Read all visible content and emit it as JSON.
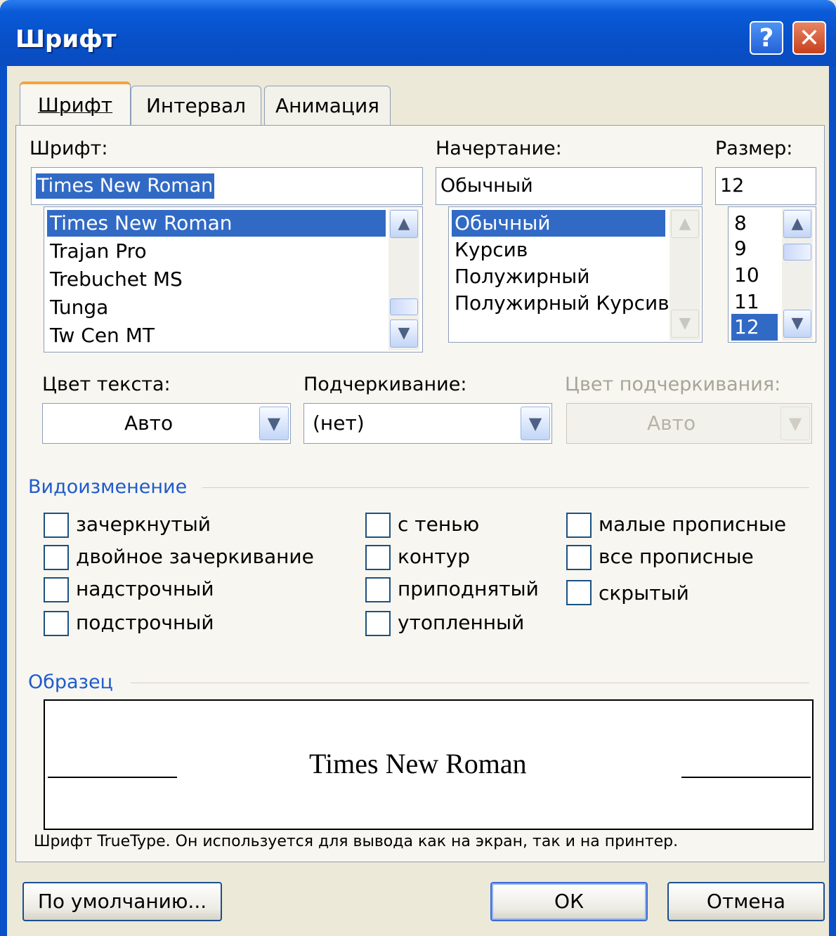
{
  "window": {
    "title": "Шрифт",
    "help_icon": "question-icon",
    "close_icon": "close-icon",
    "help_glyph": "?",
    "close_glyph": "✕"
  },
  "tabs": [
    {
      "label": "Шрифт",
      "active": true
    },
    {
      "label": "Интервал",
      "active": false
    },
    {
      "label": "Анимация",
      "active": false
    }
  ],
  "font": {
    "label": "Шрифт:",
    "value": "Times New Roman",
    "items": [
      "Times New Roman",
      "Trajan Pro",
      "Trebuchet MS",
      "Tunga",
      "Tw Cen MT"
    ],
    "selected": "Times New Roman"
  },
  "style": {
    "label": "Начертание:",
    "value": "Обычный",
    "items": [
      "Обычный",
      "Курсив",
      "Полужирный",
      "Полужирный Курсив"
    ],
    "selected": "Обычный"
  },
  "size": {
    "label": "Размер:",
    "value": "12",
    "items": [
      "8",
      "9",
      "10",
      "11",
      "12"
    ],
    "selected": "12"
  },
  "text_color": {
    "label": "Цвет текста:",
    "value": "Авто"
  },
  "underline": {
    "label": "Подчеркивание:",
    "value": "(нет)"
  },
  "underline_color": {
    "label": "Цвет подчеркивания:",
    "value": "Авто",
    "disabled": true
  },
  "effects": {
    "title": "Видоизменение",
    "items": [
      {
        "label": "зачеркнутый",
        "checked": false
      },
      {
        "label": "двойное зачеркивание",
        "checked": false
      },
      {
        "label": "надстрочный",
        "checked": false
      },
      {
        "label": "подстрочный",
        "checked": false
      },
      {
        "label": "с тенью",
        "checked": false
      },
      {
        "label": "контур",
        "checked": false
      },
      {
        "label": "приподнятый",
        "checked": false
      },
      {
        "label": "утопленный",
        "checked": false
      },
      {
        "label": "малые прописные",
        "checked": false
      },
      {
        "label": "все прописные",
        "checked": false
      },
      {
        "label": "скрытый",
        "checked": false
      }
    ]
  },
  "preview": {
    "title": "Образец",
    "text": "Times New Roman",
    "note": "Шрифт TrueType. Он используется для вывода как на экран, так и на принтер."
  },
  "buttons": {
    "default": "По умолчанию...",
    "ok": "ОК",
    "cancel": "Отмена"
  },
  "colors": {
    "titlebar": "#0750c8",
    "selection": "#316ac5",
    "group_title": "#1f5bcc",
    "dialog_bg": "#ece9d8"
  }
}
